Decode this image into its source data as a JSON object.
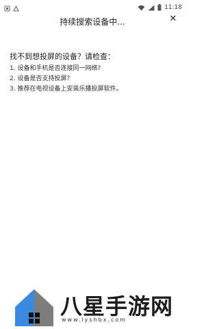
{
  "statusbar": {
    "time": "11:18",
    "icons": [
      "notification-icon",
      "alert-icon",
      "wifi-icon",
      "signal-icon",
      "battery-icon"
    ]
  },
  "header": {
    "title": "持续搜索设备中...",
    "close_label": "✕"
  },
  "help": {
    "question": "找不到想投屏的设备？请检查：",
    "steps": [
      "1. 设备和手机是否连接同一网络?",
      "2. 设备是否支持投屏?",
      "3. 推荐在电视设备上安装乐播投屏软件。"
    ]
  },
  "watermark": {
    "brand": "八星手游网",
    "url": "www.lyshbx.com"
  },
  "colors": {
    "logo_blue": "#3a8be0",
    "logo_gray": "#7d7d7d"
  }
}
